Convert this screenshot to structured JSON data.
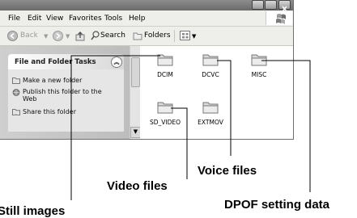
{
  "window": {
    "menu": [
      "File",
      "Edit",
      "View",
      "Favorites",
      "Tools",
      "Help"
    ],
    "toolbar": {
      "back": "Back",
      "search": "Search",
      "folders": "Folders"
    }
  },
  "task_pane": {
    "title": "File and Folder Tasks",
    "tasks": [
      {
        "label": "Make a new folder",
        "icon": "new-folder-icon"
      },
      {
        "label": "Publish this folder to the Web",
        "icon": "globe-icon"
      },
      {
        "label": "Share this folder",
        "icon": "share-folder-icon"
      }
    ]
  },
  "folders": [
    {
      "name": "DCIM",
      "callout": "Still images"
    },
    {
      "name": "DCVC",
      "callout": "Voice files"
    },
    {
      "name": "MISC",
      "callout": "DPOF setting data"
    },
    {
      "name": "SD_VIDEO",
      "callout": "Video files"
    },
    {
      "name": "EXTMOV",
      "callout": ""
    }
  ],
  "colors": {
    "folder_fill": "#d8d8d8",
    "folder_stroke": "#777777",
    "leader_line": "#000000"
  }
}
